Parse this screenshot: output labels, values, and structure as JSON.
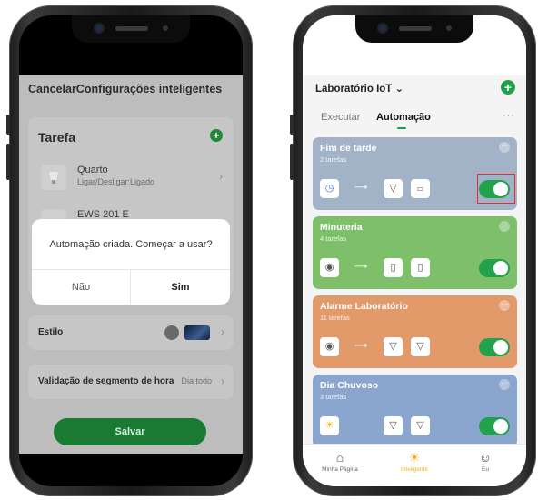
{
  "left": {
    "header": "CancelarConfigurações inteligentes",
    "task_section_title": "Tarefa",
    "plus_icon": "+",
    "tasks": [
      {
        "name": "Quarto",
        "sub": "Ligar/Desligar:Ligado"
      },
      {
        "name": "EWS 201 E",
        "sub": ""
      }
    ],
    "style_label": "Estilo",
    "validation_label": "Validação de segmento de hora",
    "validation_value": "Dia todo",
    "save_label": "Salvar",
    "dialog": {
      "message": "Automação criada. Começar a usar?",
      "no": "Não",
      "yes": "Sim"
    },
    "chevron": "›"
  },
  "right": {
    "home_title": "Laboratório IoT ⌄",
    "add_icon": "+",
    "tabs": {
      "execute": "Executar",
      "automation": "Automação",
      "more": "···"
    },
    "automations": [
      {
        "title": "Fim de tarde",
        "subtitle": "2 tarefas",
        "color": "#a3b3c7",
        "enabled": 1,
        "highlighted": true
      },
      {
        "title": "Minuteria",
        "subtitle": "4 tarefas",
        "color": "#7ebf6a",
        "enabled": 1,
        "highlighted": false
      },
      {
        "title": "Alarme Laboratório",
        "subtitle": "11 tarefas",
        "color": "#e39a6a",
        "enabled": 1,
        "highlighted": false
      },
      {
        "title": "Dia Chuvoso",
        "subtitle": "3 tarefas",
        "color": "#8aa6cf",
        "enabled": 1,
        "highlighted": false
      }
    ],
    "card_more": "···",
    "arrow": "⟶",
    "nav": [
      {
        "label": "Minha Página",
        "icon": "⌂",
        "color": "#555555"
      },
      {
        "label": "Inteligente",
        "icon": "☀",
        "color": "#f1b21a"
      },
      {
        "label": "Eu",
        "icon": "☺",
        "color": "#555555"
      }
    ],
    "accent": "#1ea24a"
  }
}
